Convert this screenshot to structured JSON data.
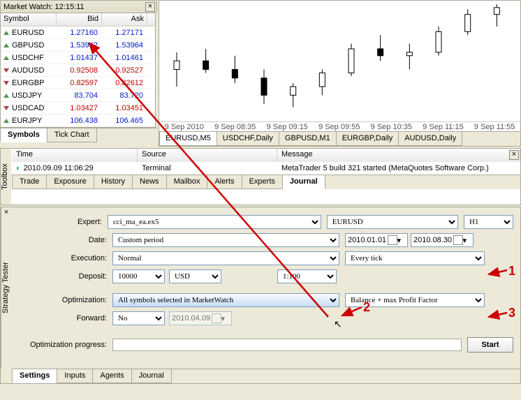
{
  "market_watch": {
    "title": "Market Watch: 12:15:11",
    "headers": {
      "symbol": "Symbol",
      "bid": "Bid",
      "ask": "Ask"
    },
    "rows": [
      {
        "sym": "EURUSD",
        "bid": "1.27160",
        "ask": "1.27171",
        "dir": "up"
      },
      {
        "sym": "GBPUSD",
        "bid": "1.53942",
        "ask": "1.53964",
        "dir": "up"
      },
      {
        "sym": "USDCHF",
        "bid": "1.01437",
        "ask": "1.01461",
        "dir": "up"
      },
      {
        "sym": "AUDUSD",
        "bid": "0.92508",
        "ask": "0.92527",
        "dir": "dn"
      },
      {
        "sym": "EURGBP",
        "bid": "0.82597",
        "ask": "0.82612",
        "dir": "dn"
      },
      {
        "sym": "USDJPY",
        "bid": "83.704",
        "ask": "83.720",
        "dir": "up"
      },
      {
        "sym": "USDCAD",
        "bid": "1.03427",
        "ask": "1.03451",
        "dir": "dn"
      },
      {
        "sym": "EURJPY",
        "bid": "106.438",
        "ask": "106.465",
        "dir": "up"
      }
    ],
    "tabs": {
      "symbols": "Symbols",
      "tick": "Tick Chart"
    }
  },
  "chart": {
    "xticks": [
      "9 Sep 2010",
      "9 Sep 08:35",
      "9 Sep 09:15",
      "9 Sep 09:55",
      "9 Sep 10:35",
      "9 Sep 11:15",
      "9 Sep 11:55"
    ],
    "tabs": [
      "EURUSD,M5",
      "USDCHF,Daily",
      "GBPUSD,M1",
      "EURGBP,Daily",
      "AUDUSD,Daily"
    ]
  },
  "toolbox": {
    "label": "Toolbox",
    "headers": {
      "time": "Time",
      "source": "Source",
      "message": "Message"
    },
    "row": {
      "time": "2010.09.09 11:06:29",
      "source": "Terminal",
      "message": "MetaTrader 5 build 321 started (MetaQuotes Software Corp.)"
    },
    "tabs": [
      "Trade",
      "Exposure",
      "History",
      "News",
      "Mailbox",
      "Alerts",
      "Experts",
      "Journal"
    ]
  },
  "tester": {
    "label": "Strategy Tester",
    "labels": {
      "expert": "Expert:",
      "date": "Date:",
      "execution": "Execution:",
      "deposit": "Deposit:",
      "optimization": "Optimization:",
      "forward": "Forward:",
      "progress": "Optimization progress:"
    },
    "values": {
      "expert": "cci_ma_ea.ex5",
      "symbol": "EURUSD",
      "period": "H1",
      "date": "Custom period",
      "date_from": "2010.01.01",
      "date_to": "2010.08.30",
      "execution": "Normal",
      "model": "Every tick",
      "deposit": "10000",
      "currency": "USD",
      "leverage": "1:100",
      "optimization": "All symbols selected in MarketWatch",
      "criterion": "Balance + max Profit Factor",
      "forward": "No",
      "forward_date": "2010.04.09",
      "start": "Start"
    },
    "tabs": [
      "Settings",
      "Inputs",
      "Agents",
      "Journal"
    ]
  },
  "annotations": {
    "a1": "1",
    "a2": "2",
    "a3": "3"
  },
  "chart_data": {
    "type": "candlestick",
    "title": "EURUSD,M5",
    "xlabel": "",
    "ylabel": "",
    "series": [
      {
        "name": "EURUSD",
        "ohlc_approx": [
          [
            1.268,
            1.269,
            1.267,
            1.2685
          ],
          [
            1.2685,
            1.2692,
            1.2678,
            1.268
          ],
          [
            1.268,
            1.2688,
            1.2672,
            1.2675
          ],
          [
            1.2675,
            1.268,
            1.266,
            1.2665
          ],
          [
            1.2665,
            1.2672,
            1.2658,
            1.267
          ],
          [
            1.267,
            1.268,
            1.2665,
            1.2678
          ],
          [
            1.2678,
            1.2695,
            1.2676,
            1.2692
          ],
          [
            1.2692,
            1.27,
            1.2685,
            1.2688
          ],
          [
            1.2688,
            1.2695,
            1.268,
            1.269
          ],
          [
            1.269,
            1.2705,
            1.2688,
            1.2702
          ],
          [
            1.2702,
            1.2715,
            1.27,
            1.2712
          ],
          [
            1.2712,
            1.2718,
            1.2705,
            1.2716
          ]
        ]
      }
    ],
    "xticks": [
      "9 Sep 2010",
      "9 Sep 08:35",
      "9 Sep 09:15",
      "9 Sep 09:55",
      "9 Sep 10:35",
      "9 Sep 11:15",
      "9 Sep 11:55"
    ]
  }
}
